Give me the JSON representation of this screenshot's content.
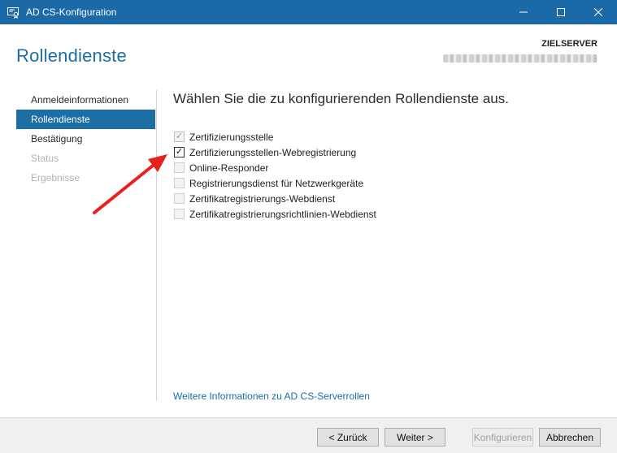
{
  "window": {
    "title": "AD CS-Konfiguration",
    "controls": {
      "minimize": "—",
      "maximize": "☐",
      "close": "✕"
    }
  },
  "header": {
    "page_title": "Rollendienste",
    "target_label": "ZIELSERVER"
  },
  "sidebar": {
    "items": [
      {
        "label": "Anmeldeinformationen",
        "state": "normal"
      },
      {
        "label": "Rollendienste",
        "state": "active"
      },
      {
        "label": "Bestätigung",
        "state": "normal"
      },
      {
        "label": "Status",
        "state": "disabled"
      },
      {
        "label": "Ergebnisse",
        "state": "disabled"
      }
    ]
  },
  "main": {
    "instructions": "Wählen Sie die zu konfigurierenden Rollendienste aus.",
    "options": [
      {
        "label": "Zertifizierungsstelle",
        "checked": true,
        "enabled": false
      },
      {
        "label": "Zertifizierungsstellen-Webregistrierung",
        "checked": true,
        "enabled": true
      },
      {
        "label": "Online-Responder",
        "checked": false,
        "enabled": false
      },
      {
        "label": "Registrierungsdienst für Netzwerkgeräte",
        "checked": false,
        "enabled": false
      },
      {
        "label": "Zertifikatregistrierungs-Webdienst",
        "checked": false,
        "enabled": false
      },
      {
        "label": "Zertifikatregistrierungsrichtlinien-Webdienst",
        "checked": false,
        "enabled": false
      }
    ],
    "more_info_link": "Weitere Informationen zu AD CS-Serverrollen"
  },
  "footer": {
    "back": "< Zurück",
    "next": "Weiter >",
    "configure": "Konfigurieren",
    "cancel": "Abbrechen"
  },
  "colors": {
    "titlebar": "#1b6aa7",
    "accent": "#1c6ea4",
    "arrow": "#e8201e"
  },
  "icons": {
    "app": "certificate-icon",
    "check": "checkmark-icon"
  }
}
